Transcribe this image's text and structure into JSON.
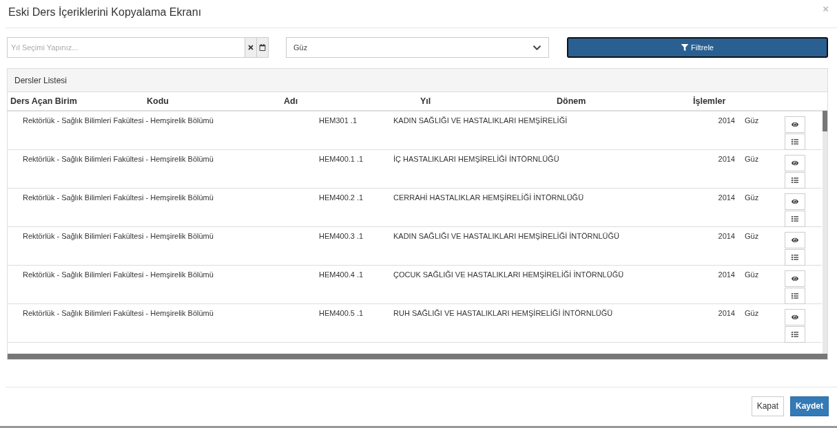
{
  "window": {
    "title": "Eski Ders İçeriklerini Kopyalama Ekranı",
    "close": "×"
  },
  "filters": {
    "year": {
      "placeholder": "Yıl Seçimi Yapınız..."
    },
    "term": {
      "value": "Güz"
    },
    "button": "Filtrele"
  },
  "panel": {
    "title": "Dersler Listesi"
  },
  "table": {
    "columns": [
      "Ders Açan Birim",
      "Kodu",
      "Adı",
      "Yıl",
      "Dönem",
      "İşlemler"
    ],
    "rows": [
      {
        "unit": "Rektörlük - Sağlık Bilimleri Fakültesi - Hemşirelik Bölümü",
        "code": "HEM301 .1",
        "name": "KADIN SAĞLIĞI VE HASTALIKLARI HEMŞİRELİĞİ",
        "year": "2014",
        "term": "Güz"
      },
      {
        "unit": "Rektörlük - Sağlık Bilimleri Fakültesi - Hemşirelik Bölümü",
        "code": "HEM400.1 .1",
        "name": "İÇ HASTALIKLARI HEMŞİRELİĞİ İNTÖRNLÜĞÜ",
        "year": "2014",
        "term": "Güz"
      },
      {
        "unit": "Rektörlük - Sağlık Bilimleri Fakültesi - Hemşirelik Bölümü",
        "code": "HEM400.2 .1",
        "name": "CERRAHİ HASTALIKLAR HEMŞİRELİĞİ İNTÖRNLÜĞÜ",
        "year": "2014",
        "term": "Güz"
      },
      {
        "unit": "Rektörlük - Sağlık Bilimleri Fakültesi - Hemşirelik Bölümü",
        "code": "HEM400.3 .1",
        "name": "KADIN SAĞLIĞI VE HASTALIKLARI HEMŞİRELİĞİ İNTÖRNLÜĞÜ",
        "year": "2014",
        "term": "Güz"
      },
      {
        "unit": "Rektörlük - Sağlık Bilimleri Fakültesi - Hemşirelik Bölümü",
        "code": "HEM400.4 .1",
        "name": "ÇOCUK SAĞLIĞI VE HASTALIKLARI HEMŞİRELİĞİ İNTÖRNLÜĞÜ",
        "year": "2014",
        "term": "Güz"
      },
      {
        "unit": "Rektörlük - Sağlık Bilimleri Fakültesi - Hemşirelik Bölümü",
        "code": "HEM400.5 .1",
        "name": "RUH SAĞLIĞI VE HASTALIKLARI HEMŞİRELİĞİ İNTÖRNLÜĞÜ",
        "year": "2014",
        "term": "Güz"
      }
    ]
  },
  "footer": {
    "buttons": [
      "Kapat",
      "Kaydet"
    ]
  }
}
